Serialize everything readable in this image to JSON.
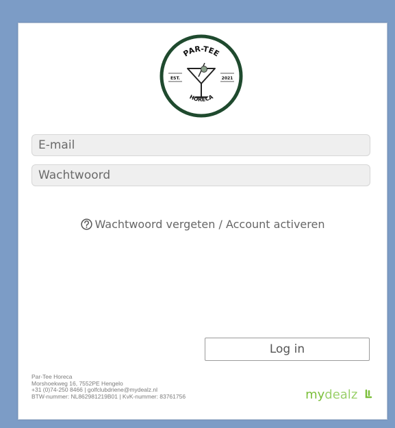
{
  "logo": {
    "top_text": "PAR-TEE",
    "est_label": "EST.",
    "year": "2021",
    "bottom_text": "HORECA",
    "colors": {
      "ring": "#1f4a2e",
      "olive": "#8aa08a"
    }
  },
  "form": {
    "email_placeholder": "E-mail",
    "password_placeholder": "Wachtwoord",
    "forgot_link": "Wachtwoord vergeten / Account activeren",
    "login_button": "Log in"
  },
  "footer": {
    "line1": "Par-Tee Horeca",
    "line2": "Morshoekweg 16, 7552PE Hengelo",
    "line3": "+31 (0)74-250 8466 | golfclubdriene@mydealz.nl",
    "line4": "BTW-nummer: NL862981219B01 | KvK-nummer: 83761756"
  },
  "brand": {
    "name_bold": "my",
    "name_light": "dealz",
    "color": "#7bbf3a"
  }
}
